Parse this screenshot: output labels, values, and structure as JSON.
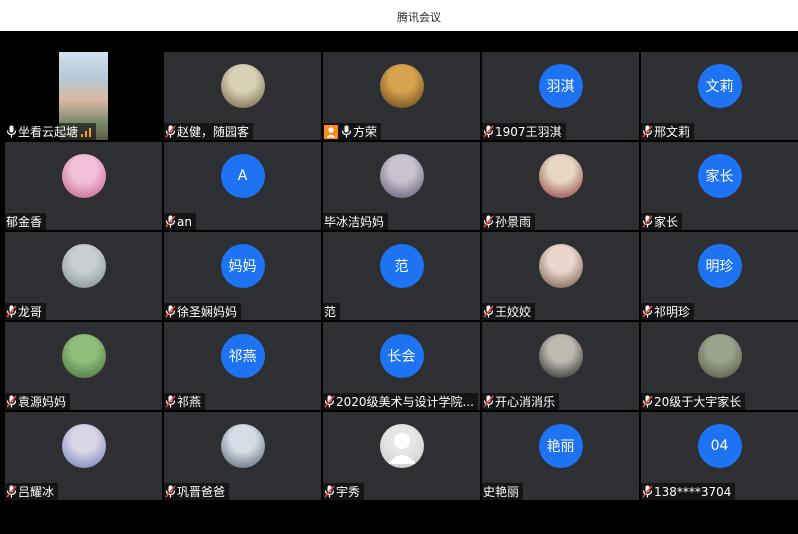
{
  "window": {
    "title": "腾讯会议"
  },
  "participants": [
    {
      "name": "坐看云起塘",
      "avatar_type": "video",
      "mic": "on",
      "signal": true
    },
    {
      "name": "赵健，随园客",
      "avatar_type": "photo",
      "photo_colors": [
        "#d9d2b6",
        "#6b5a3a"
      ],
      "mic": "muted"
    },
    {
      "name": "方荣",
      "avatar_type": "photo",
      "photo_colors": [
        "#d7a44e",
        "#5a3a1a"
      ],
      "mic": "on",
      "host": true
    },
    {
      "name": "1907王羽淇",
      "avatar_type": "letters",
      "avatar_text": "羽淇",
      "mic": "muted"
    },
    {
      "name": "邢文莉",
      "avatar_type": "letters",
      "avatar_text": "文莉",
      "mic": "muted"
    },
    {
      "name": "郁金香",
      "avatar_type": "photo",
      "photo_colors": [
        "#f2c0d8",
        "#c25a86"
      ],
      "mic": "none"
    },
    {
      "name": "an",
      "avatar_type": "letters",
      "avatar_text": "A",
      "mic": "muted"
    },
    {
      "name": "毕冰洁妈妈",
      "avatar_type": "photo",
      "photo_colors": [
        "#c9c2cf",
        "#5a4f66"
      ],
      "mic": "none"
    },
    {
      "name": "孙景雨",
      "avatar_type": "photo",
      "photo_colors": [
        "#e7d8c2",
        "#8a2f2f"
      ],
      "mic": "muted"
    },
    {
      "name": "家长",
      "avatar_type": "letters",
      "avatar_text": "家长",
      "mic": "muted"
    },
    {
      "name": "龙哥",
      "avatar_type": "photo",
      "photo_colors": [
        "#c8ced2",
        "#7d8a86"
      ],
      "mic": "muted"
    },
    {
      "name": "徐圣娴妈妈",
      "avatar_type": "letters",
      "avatar_text": "妈妈",
      "mic": "muted"
    },
    {
      "name": "范",
      "avatar_type": "letters",
      "avatar_text": "范",
      "mic": "none"
    },
    {
      "name": "王姣姣",
      "avatar_type": "photo",
      "photo_colors": [
        "#e9d6cc",
        "#6a4a3a"
      ],
      "mic": "muted"
    },
    {
      "name": "祁明珍",
      "avatar_type": "letters",
      "avatar_text": "明珍",
      "mic": "muted"
    },
    {
      "name": "袁源妈妈",
      "avatar_type": "photo",
      "photo_colors": [
        "#8fbf7a",
        "#3f6a3a"
      ],
      "mic": "muted"
    },
    {
      "name": "祁燕",
      "avatar_type": "letters",
      "avatar_text": "祁燕",
      "mic": "muted"
    },
    {
      "name": "2020级美术与设计学院...",
      "avatar_type": "letters",
      "avatar_text": "长会",
      "mic": "muted"
    },
    {
      "name": "开心消消乐",
      "avatar_type": "photo",
      "photo_colors": [
        "#bfb9b2",
        "#1a1a1a"
      ],
      "mic": "muted"
    },
    {
      "name": "20级于大宇家长",
      "avatar_type": "photo",
      "photo_colors": [
        "#9aa48a",
        "#4a523a"
      ],
      "mic": "muted"
    },
    {
      "name": "吕耀冰",
      "avatar_type": "photo",
      "photo_colors": [
        "#d9d4e6",
        "#6a7ab8"
      ],
      "mic": "muted"
    },
    {
      "name": "巩晋爸爸",
      "avatar_type": "photo",
      "photo_colors": [
        "#d6dde6",
        "#4a5a6a"
      ],
      "mic": "muted"
    },
    {
      "name": "宇秀",
      "avatar_type": "default",
      "photo_colors": [
        "#e6e6e6",
        "#c8c8c8"
      ],
      "mic": "muted"
    },
    {
      "name": "史艳丽",
      "avatar_type": "letters",
      "avatar_text": "艳丽",
      "mic": "none"
    },
    {
      "name": "138****3704",
      "avatar_type": "letters",
      "avatar_text": "04",
      "mic": "muted"
    }
  ],
  "colors": {
    "avatar_blue": "#1d73f2",
    "tile_bg": "#2d2f33",
    "muted_red": "#e84b3c",
    "host_orange": "#ff8a1e"
  }
}
